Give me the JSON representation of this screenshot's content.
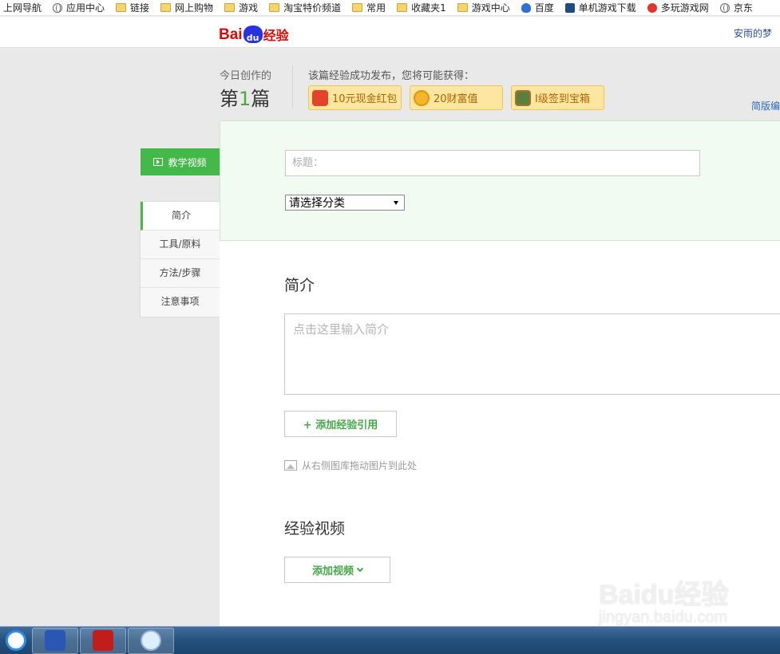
{
  "bookmarks": [
    {
      "label": "上网导航",
      "icon": "none"
    },
    {
      "label": "应用中心",
      "icon": "globe-icon"
    },
    {
      "label": "链接",
      "icon": "folder-icon"
    },
    {
      "label": "网上购物",
      "icon": "folder-icon"
    },
    {
      "label": "游戏",
      "icon": "folder-icon"
    },
    {
      "label": "淘宝特价频道",
      "icon": "folder-icon"
    },
    {
      "label": "常用",
      "icon": "folder-icon"
    },
    {
      "label": "收藏夹1",
      "icon": "folder-icon"
    },
    {
      "label": "游戏中心",
      "icon": "folder-icon"
    },
    {
      "label": "百度",
      "icon": "baidu-paw-icon"
    },
    {
      "label": "单机游戏下载",
      "icon": "game-icon"
    },
    {
      "label": "多玩游戏网",
      "icon": "duowan-icon"
    },
    {
      "label": "京东",
      "icon": "globe-icon"
    }
  ],
  "header": {
    "logo": {
      "bai": "Bai",
      "du": "du",
      "jingyan": "经验"
    },
    "user_name": "安雨的梦"
  },
  "stats": {
    "today_label": "今日创作的",
    "count_prefix": "第",
    "count": "1",
    "count_suffix": "篇",
    "reward_heading": "该篇经验成功发布，您将可能获得：",
    "rewards": [
      {
        "label": "10元现金红包",
        "icon": "red-envelope-icon"
      },
      {
        "label": "20财富值",
        "icon": "coin-icon"
      },
      {
        "label": "I级签到宝箱",
        "icon": "treasure-chest-icon"
      }
    ],
    "mode_link": "简版编"
  },
  "side_nav": {
    "video_tab": "教学视频",
    "items": [
      "简介",
      "工具/原料",
      "方法/步骤",
      "注意事项"
    ],
    "active_index": 0
  },
  "form": {
    "title_placeholder": "标题：",
    "category_selected": "请选择分类",
    "intro_heading": "简介",
    "intro_placeholder": "点击这里输入简介",
    "add_quote_label": "+ 添加经验引用",
    "drag_hint": "从右侧图库拖动图片到此处",
    "video_heading": "经验视频",
    "add_video_label": "添加视频"
  },
  "watermark": {
    "logo": "Baidu经验",
    "url": "jingyan.baidu.com"
  },
  "taskbar": {
    "apps": [
      "baidu-netdisk-icon",
      "word-icon",
      "pdf-reader-icon",
      "browser-icon"
    ]
  },
  "colors": {
    "accent_green": "#45b84a",
    "baidu_red": "#e10602",
    "baidu_blue": "#2932e1"
  }
}
